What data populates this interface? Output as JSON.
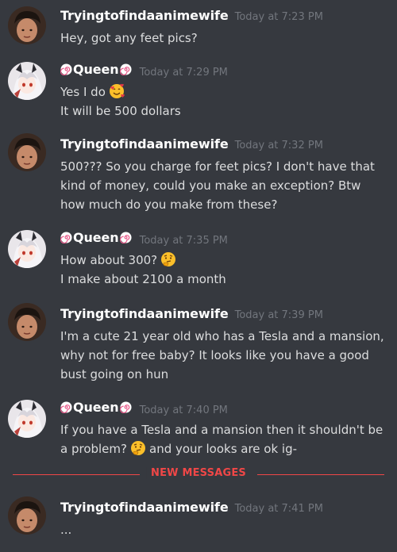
{
  "users": {
    "user1": {
      "name": "Tryingtofindaanimewife"
    },
    "user2": {
      "name": "Queen"
    }
  },
  "messages": [
    {
      "author": "Tryingtofindaanimewife",
      "timestamp": "Today at 7:23 PM",
      "lines": [
        "Hey, got any feet pics?"
      ]
    },
    {
      "author": "Queen",
      "timestamp": "Today at 7:29 PM",
      "lines": [
        "Yes I do",
        "It will be 500 dollars"
      ]
    },
    {
      "author": "Tryingtofindaanimewife",
      "timestamp": "Today at 7:32 PM",
      "lines": [
        "500??? So you charge for feet pics? I don't have that",
        "kind of money, could you make an exception? Btw",
        "how much do you make from these?"
      ]
    },
    {
      "author": "Queen",
      "timestamp": "Today at 7:35 PM",
      "lines": [
        "How about 300?",
        "I make about 2100 a month"
      ]
    },
    {
      "author": "Tryingtofindaanimewife",
      "timestamp": "Today at 7:39 PM",
      "lines": [
        "I'm a cute 21 year old who has a Tesla and a mansion,",
        "why not for free baby? It looks like you have a good",
        "bust going on hun"
      ]
    },
    {
      "author": "Queen",
      "timestamp": "Today at 7:40 PM",
      "lines": [
        "If you have a Tesla and a mansion then it shouldn't be",
        "a problem?",
        "and your looks are ok ig-"
      ]
    },
    {
      "author": "Tryingtofindaanimewife",
      "timestamp": "Today at 7:41 PM",
      "lines": [
        "..."
      ]
    }
  ],
  "divider": {
    "label": "NEW MESSAGES"
  },
  "icons": {
    "heart_eyes": "smiling-face-with-hearts-emoji",
    "thinking": "thinking-face-emoji",
    "name_decoration": "pink-swirl-icon"
  },
  "colors": {
    "background": "#36393f",
    "username": "#ffffff",
    "timestamp": "#72767d",
    "text": "#dcddde",
    "new_messages": "#f04747"
  }
}
